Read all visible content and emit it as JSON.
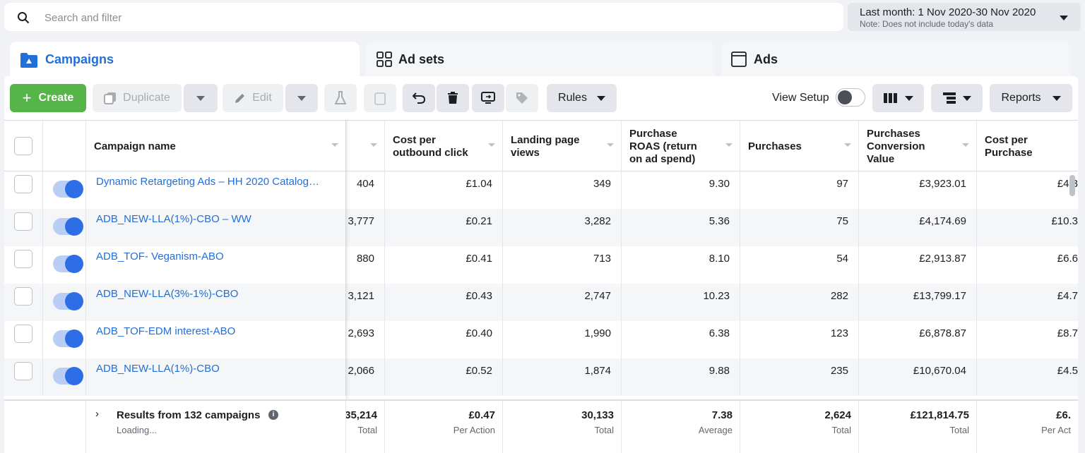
{
  "search": {
    "placeholder": "Search and filter"
  },
  "date_range": {
    "label": "Last month: 1 Nov 2020-30 Nov 2020",
    "note": "Note: Does not include today's data"
  },
  "tabs": [
    {
      "label": "Campaigns",
      "active": true,
      "icon": "folder-icon"
    },
    {
      "label": "Ad sets",
      "active": false,
      "icon": "grid-icon"
    },
    {
      "label": "Ads",
      "active": false,
      "icon": "window-icon"
    }
  ],
  "toolbar": {
    "create": "Create",
    "duplicate": "Duplicate",
    "edit": "Edit",
    "rules": "Rules",
    "view_setup": "View Setup",
    "reports": "Reports"
  },
  "columns": {
    "name": "Campaign name",
    "cost_outbound": [
      "Cost per",
      "outbound click"
    ],
    "landing": [
      "Landing page",
      "views"
    ],
    "roas": [
      "Purchase",
      "ROAS (return",
      "on ad spend)"
    ],
    "purchases": "Purchases",
    "conv_value": [
      "Purchases",
      "Conversion",
      "Value"
    ],
    "cost_purchase": [
      "Cost per",
      "Purchase"
    ]
  },
  "rows": [
    {
      "name": "Dynamic Retargeting Ads – HH 2020 Catalog…",
      "c0": "404",
      "c1": "£1.04",
      "c2": "349",
      "c3": "9.30",
      "c4": "97",
      "c5": "£3,923.01",
      "c6": "£4.3"
    },
    {
      "name": "ADB_NEW-LLA(1%)-CBO – WW",
      "c0": "3,777",
      "c1": "£0.21",
      "c2": "3,282",
      "c3": "5.36",
      "c4": "75",
      "c5": "£4,174.69",
      "c6": "£10.3"
    },
    {
      "name": "ADB_TOF- Veganism-ABO",
      "c0": "880",
      "c1": "£0.41",
      "c2": "713",
      "c3": "8.10",
      "c4": "54",
      "c5": "£2,913.87",
      "c6": "£6.6"
    },
    {
      "name": "ADB_NEW-LLA(3%-1%)-CBO",
      "c0": "3,121",
      "c1": "£0.43",
      "c2": "2,747",
      "c3": "10.23",
      "c4": "282",
      "c5": "£13,799.17",
      "c6": "£4.7"
    },
    {
      "name": "ADB_TOF-EDM interest-ABO",
      "c0": "2,693",
      "c1": "£0.40",
      "c2": "1,990",
      "c3": "6.38",
      "c4": "123",
      "c5": "£6,878.87",
      "c6": "£8.7"
    },
    {
      "name": "ADB_NEW-LLA(1%)-CBO",
      "c0": "2,066",
      "c1": "£0.52",
      "c2": "1,874",
      "c3": "9.88",
      "c4": "235",
      "c5": "£10,670.04",
      "c6": "£4.5"
    }
  ],
  "totals": {
    "label": "Results from 132 campaigns",
    "loading": "Loading...",
    "c0": {
      "value": "35,214",
      "label": "Total"
    },
    "c1": {
      "value": "£0.47",
      "label": "Per Action"
    },
    "c2": {
      "value": "30,133",
      "label": "Total"
    },
    "c3": {
      "value": "7.38",
      "label": "Average"
    },
    "c4": {
      "value": "2,624",
      "label": "Total"
    },
    "c5": {
      "value": "£121,814.75",
      "label": "Total"
    },
    "c6": {
      "value": "£6.",
      "label": "Per Act"
    }
  },
  "colors": {
    "accent": "#216fdb",
    "create": "#55b548",
    "toggle_on": "#2d6ee6"
  }
}
